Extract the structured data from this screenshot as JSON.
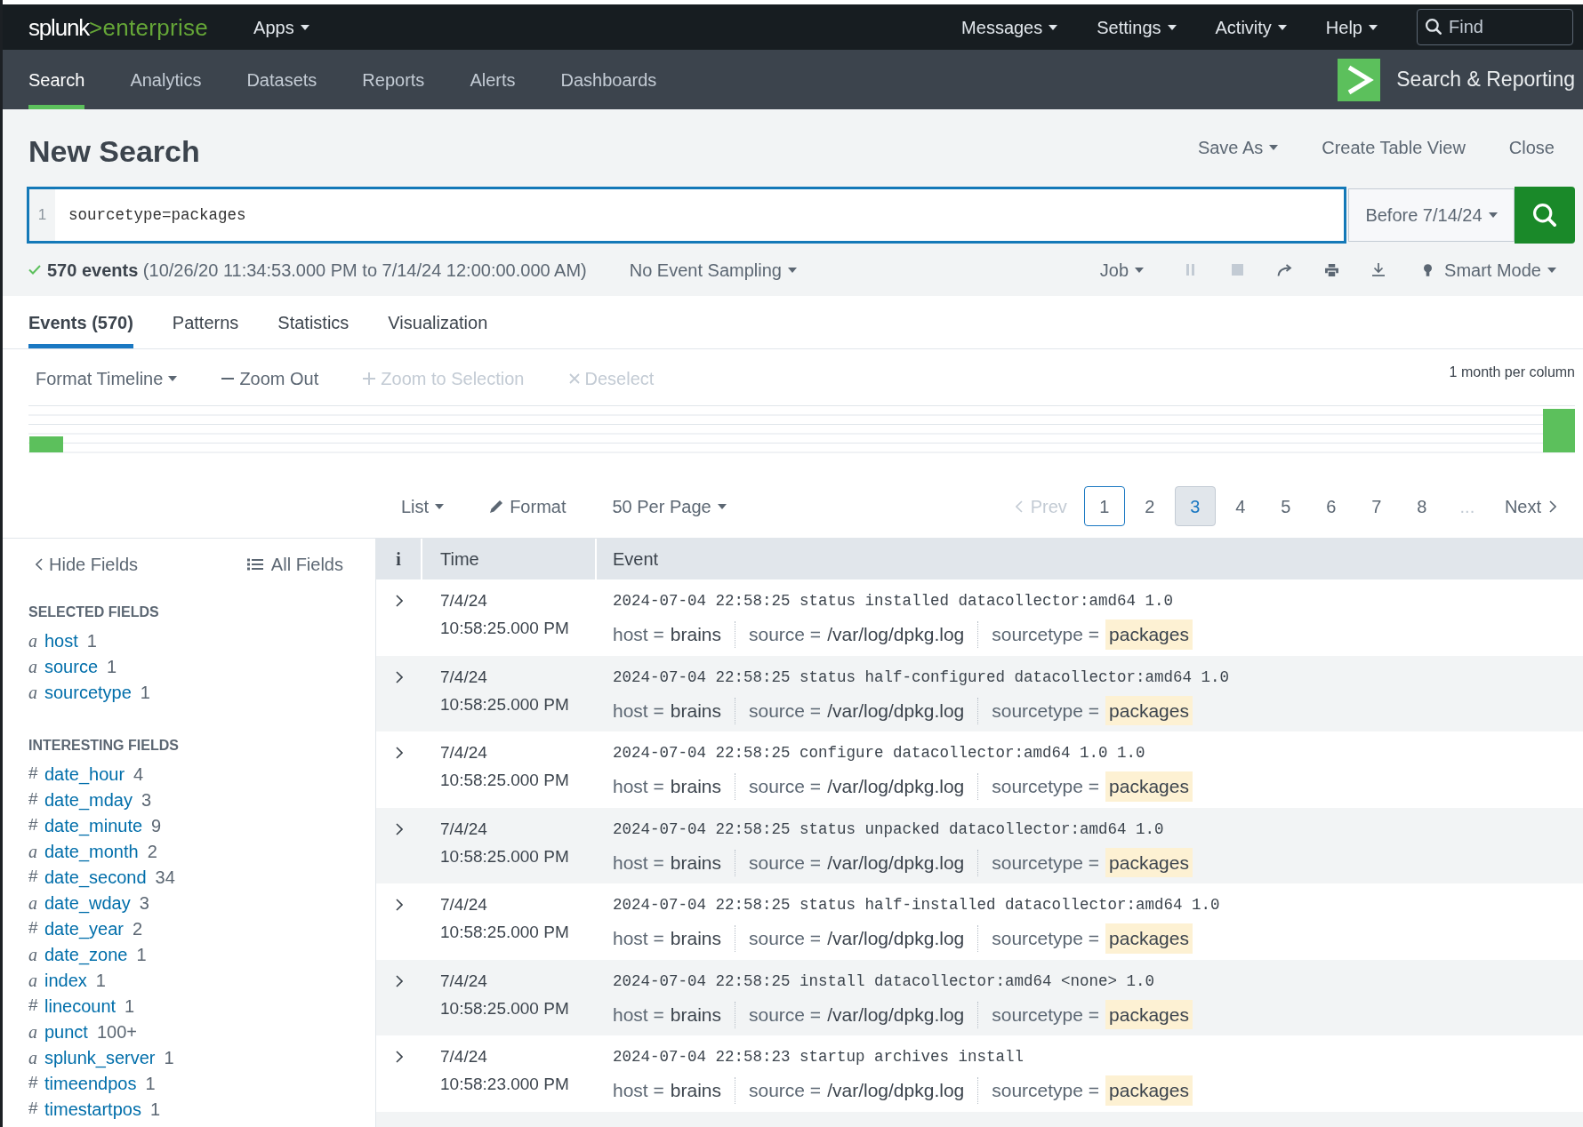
{
  "top_bar": {
    "logo": {
      "brand": "splunk",
      "product": ">enterprise"
    },
    "apps_menu": "Apps",
    "menus": [
      "Messages",
      "Settings",
      "Activity",
      "Help"
    ],
    "find": {
      "placeholder": "Find"
    }
  },
  "app_bar": {
    "tabs": [
      {
        "label": "Search",
        "selected": true
      },
      {
        "label": "Analytics",
        "selected": false
      },
      {
        "label": "Datasets",
        "selected": false
      },
      {
        "label": "Reports",
        "selected": false
      },
      {
        "label": "Alerts",
        "selected": false
      },
      {
        "label": "Dashboards",
        "selected": false
      }
    ],
    "app_title": "Search & Reporting"
  },
  "page_header": {
    "title": "New Search",
    "actions": [
      {
        "label": "Save As",
        "dropdown": true
      },
      {
        "label": "Create Table View",
        "dropdown": false
      },
      {
        "label": "Close",
        "dropdown": false
      }
    ]
  },
  "search_bar": {
    "line_number": "1",
    "query": "sourcetype=packages",
    "time_range": "Before 7/14/24"
  },
  "job_status": {
    "summary": "**570 events** (10/26/20 11:34:53.000 PM to 7/14/24 12:00:00.000 AM)",
    "sampling": "No Event Sampling",
    "job_menu": "Job",
    "actions": [
      {
        "kind": "pause",
        "disabled": true
      },
      {
        "kind": "stop",
        "disabled": true
      },
      {
        "kind": "share",
        "disabled": false
      },
      {
        "kind": "print",
        "disabled": false
      },
      {
        "kind": "export",
        "disabled": false
      }
    ],
    "mode": "Smart Mode"
  },
  "result_tabs": [
    {
      "label": "Events (570)",
      "selected": true
    },
    {
      "label": "Patterns",
      "selected": false
    },
    {
      "label": "Statistics",
      "selected": false
    },
    {
      "label": "Visualization",
      "selected": false
    }
  ],
  "timeline": {
    "controls": [
      {
        "kind": "menu",
        "label": "Format Timeline",
        "disabled": false
      },
      {
        "kind": "zoom_out",
        "label": "Zoom Out",
        "disabled": false
      },
      {
        "kind": "zoom_in",
        "label": "Zoom to Selection",
        "disabled": true
      },
      {
        "kind": "deselect",
        "label": "Deselect",
        "disabled": true
      }
    ],
    "scale_label": "1 month per column"
  },
  "results_toolbar": {
    "view_menu": "List",
    "format": "Format",
    "per_page_menu": "50 Per Page"
  },
  "pagination": {
    "prev": {
      "label": "Prev",
      "disabled": true
    },
    "pages": [
      {
        "label": "1",
        "selected": true,
        "hovered": false
      },
      {
        "label": "2",
        "selected": false,
        "hovered": false
      },
      {
        "label": "3",
        "selected": false,
        "hovered": true
      },
      {
        "label": "4",
        "selected": false,
        "hovered": false
      },
      {
        "label": "5",
        "selected": false,
        "hovered": false
      },
      {
        "label": "6",
        "selected": false,
        "hovered": false
      },
      {
        "label": "7",
        "selected": false,
        "hovered": false
      },
      {
        "label": "8",
        "selected": false,
        "hovered": false
      }
    ],
    "ellipsis": "...",
    "next": {
      "label": "Next",
      "disabled": false
    }
  },
  "fields_sidebar": {
    "hide_fields": "Hide Fields",
    "all_fields": "All Fields",
    "groups": [
      {
        "title": "SELECTED FIELDS",
        "fields": [
          {
            "kind": "string",
            "glyph": "a",
            "name": "host",
            "count": "1"
          },
          {
            "kind": "string",
            "glyph": "a",
            "name": "source",
            "count": "1"
          },
          {
            "kind": "string",
            "glyph": "a",
            "name": "sourcetype",
            "count": "1"
          }
        ]
      },
      {
        "title": "INTERESTING FIELDS",
        "fields": [
          {
            "kind": "number",
            "glyph": "#",
            "name": "date_hour",
            "count": "4"
          },
          {
            "kind": "number",
            "glyph": "#",
            "name": "date_mday",
            "count": "3"
          },
          {
            "kind": "number",
            "glyph": "#",
            "name": "date_minute",
            "count": "9"
          },
          {
            "kind": "string",
            "glyph": "a",
            "name": "date_month",
            "count": "2"
          },
          {
            "kind": "number",
            "glyph": "#",
            "name": "date_second",
            "count": "34"
          },
          {
            "kind": "string",
            "glyph": "a",
            "name": "date_wday",
            "count": "3"
          },
          {
            "kind": "number",
            "glyph": "#",
            "name": "date_year",
            "count": "2"
          },
          {
            "kind": "string",
            "glyph": "a",
            "name": "date_zone",
            "count": "1"
          },
          {
            "kind": "string",
            "glyph": "a",
            "name": "index",
            "count": "1"
          },
          {
            "kind": "number",
            "glyph": "#",
            "name": "linecount",
            "count": "1"
          },
          {
            "kind": "string",
            "glyph": "a",
            "name": "punct",
            "count": "100+"
          },
          {
            "kind": "string",
            "glyph": "a",
            "name": "splunk_server",
            "count": "1"
          },
          {
            "kind": "number",
            "glyph": "#",
            "name": "timeendpos",
            "count": "1"
          },
          {
            "kind": "number",
            "glyph": "#",
            "name": "timestartpos",
            "count": "1"
          }
        ]
      }
    ]
  },
  "events_table": {
    "columns": [
      "i",
      "Time",
      "Event"
    ],
    "rows": [
      {
        "expanded": false,
        "date": "7/4/24",
        "time": "10:58:25.000 PM",
        "raw": "2024-07-04 22:58:25 status installed datacollector:amd64 1.0",
        "fields": [
          {
            "label": "host =",
            "value": "brains",
            "highlighted": false
          },
          {
            "label": "source =",
            "value": "/var/log/dpkg.log",
            "highlighted": false
          },
          {
            "label": "sourcetype =",
            "value": "packages",
            "highlighted": true
          }
        ]
      },
      {
        "expanded": false,
        "date": "7/4/24",
        "time": "10:58:25.000 PM",
        "raw": "2024-07-04 22:58:25 status half-configured datacollector:amd64 1.0",
        "fields": [
          {
            "label": "host =",
            "value": "brains",
            "highlighted": false
          },
          {
            "label": "source =",
            "value": "/var/log/dpkg.log",
            "highlighted": false
          },
          {
            "label": "sourcetype =",
            "value": "packages",
            "highlighted": true
          }
        ]
      },
      {
        "expanded": false,
        "date": "7/4/24",
        "time": "10:58:25.000 PM",
        "raw": "2024-07-04 22:58:25 configure datacollector:amd64 1.0 1.0",
        "fields": [
          {
            "label": "host =",
            "value": "brains",
            "highlighted": false
          },
          {
            "label": "source =",
            "value": "/var/log/dpkg.log",
            "highlighted": false
          },
          {
            "label": "sourcetype =",
            "value": "packages",
            "highlighted": true
          }
        ]
      },
      {
        "expanded": false,
        "date": "7/4/24",
        "time": "10:58:25.000 PM",
        "raw": "2024-07-04 22:58:25 status unpacked datacollector:amd64 1.0",
        "fields": [
          {
            "label": "host =",
            "value": "brains",
            "highlighted": false
          },
          {
            "label": "source =",
            "value": "/var/log/dpkg.log",
            "highlighted": false
          },
          {
            "label": "sourcetype =",
            "value": "packages",
            "highlighted": true
          }
        ]
      },
      {
        "expanded": false,
        "date": "7/4/24",
        "time": "10:58:25.000 PM",
        "raw": "2024-07-04 22:58:25 status half-installed datacollector:amd64 1.0",
        "fields": [
          {
            "label": "host =",
            "value": "brains",
            "highlighted": false
          },
          {
            "label": "source =",
            "value": "/var/log/dpkg.log",
            "highlighted": false
          },
          {
            "label": "sourcetype =",
            "value": "packages",
            "highlighted": true
          }
        ]
      },
      {
        "expanded": false,
        "date": "7/4/24",
        "time": "10:58:25.000 PM",
        "raw": "2024-07-04 22:58:25 install datacollector:amd64 <none> 1.0",
        "fields": [
          {
            "label": "host =",
            "value": "brains",
            "highlighted": false
          },
          {
            "label": "source =",
            "value": "/var/log/dpkg.log",
            "highlighted": false
          },
          {
            "label": "sourcetype =",
            "value": "packages",
            "highlighted": true
          }
        ]
      },
      {
        "expanded": false,
        "date": "7/4/24",
        "time": "10:58:23.000 PM",
        "raw": "2024-07-04 22:58:23 startup archives install",
        "fields": [
          {
            "label": "host =",
            "value": "brains",
            "highlighted": false
          },
          {
            "label": "source =",
            "value": "/var/log/dpkg.log",
            "highlighted": false
          },
          {
            "label": "sourcetype =",
            "value": "packages",
            "highlighted": true
          }
        ]
      }
    ]
  }
}
